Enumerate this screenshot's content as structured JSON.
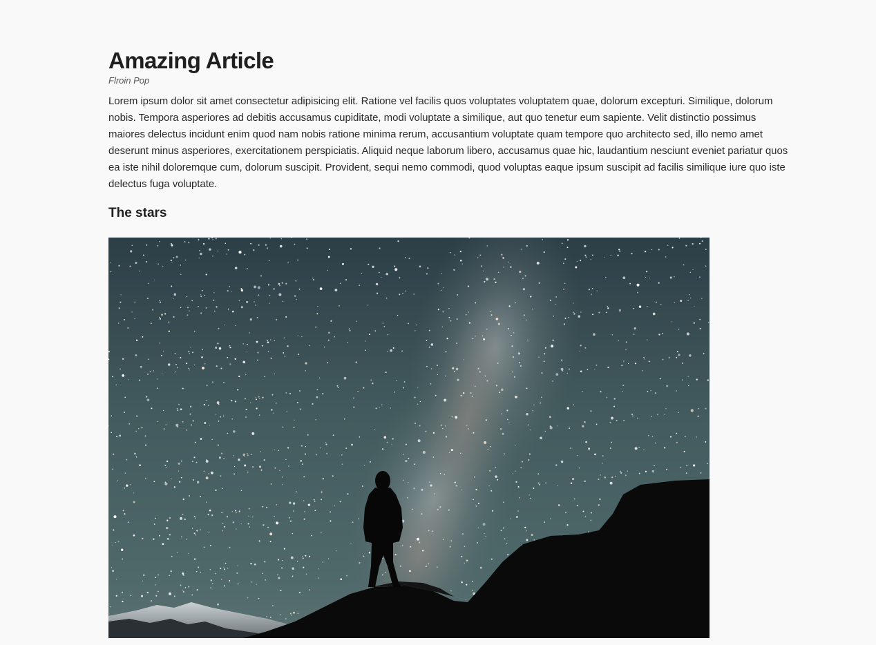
{
  "article": {
    "title": "Amazing Article",
    "author": "Flroin Pop",
    "body": "Lorem ipsum dolor sit amet consectetur adipisicing elit. Ratione vel facilis quos voluptates voluptatem quae, dolorum excepturi. Similique, dolorum nobis. Tempora asperiores ad debitis accusamus cupiditate, modi voluptate a similique, aut quo tenetur eum sapiente. Velit distinctio possimus maiores delectus incidunt enim quod nam nobis ratione minima rerum, accusantium voluptate quam tempore quo architecto sed, illo nemo amet deserunt minus asperiores, exercitationem perspiciatis. Aliquid neque laborum libero, accusamus quae hic, laudantium nesciunt eveniet pariatur quos ea iste nihil doloremque cum, dolorum suscipit. Provident, sequi nemo commodi, quod voluptas eaque ipsum suscipit ad facilis similique iure quo iste delectus fuga voluptate.",
    "section_heading": "The stars"
  },
  "image": {
    "subject": "night-sky-milky-way-silhouette"
  },
  "colors": {
    "background": "#f9f9f9",
    "text": "#2a2a2a",
    "sky_top": "#2f4249",
    "sky_mid": "#4b6466",
    "mountain": "#0b0b0b"
  }
}
